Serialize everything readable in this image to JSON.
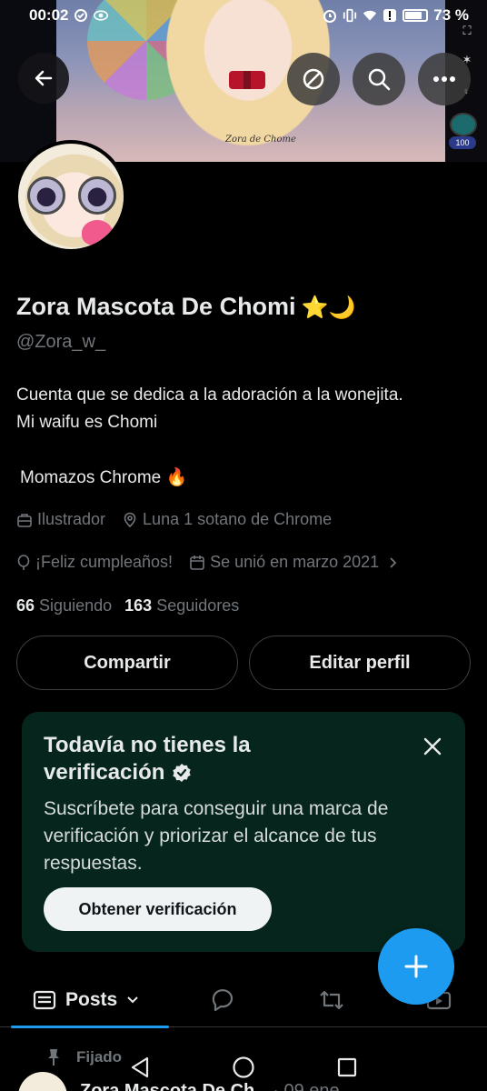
{
  "status_bar": {
    "time": "00:02",
    "battery": "73 %",
    "icons": [
      "data-saver-icon",
      "eye-icon",
      "alarm-icon",
      "vibrate-icon",
      "wifi-icon",
      "alert-icon",
      "battery-icon"
    ]
  },
  "banner": {
    "signature": "Zora de Chome",
    "sidebar_badge": "100"
  },
  "nav": {
    "icons": [
      "back-arrow-icon",
      "data-saver-icon",
      "search-icon",
      "more-icon"
    ]
  },
  "profile": {
    "name": "Zora Mascota De Chomi",
    "name_emoji": "⭐🌙",
    "handle": "@Zora_w_",
    "bio_line1": "Cuenta que se dedica a la adoración a la wonejita.",
    "bio_line2": "Mi waifu es Chomi",
    "bio_line3": "Momazos Chrome 🔥",
    "job": "Ilustrador",
    "location": "Luna 1 sotano de Chrome",
    "birthday": "¡Feliz cumpleaños!",
    "joined": "Se unió en marzo 2021",
    "following_count": "66",
    "following_label": "Siguiendo",
    "followers_count": "163",
    "followers_label": "Seguidores"
  },
  "buttons": {
    "share": "Compartir",
    "edit": "Editar perfil"
  },
  "verification": {
    "title_line1": "Todavía no tienes la",
    "title_line2": "verificación",
    "body": "Suscríbete para conseguir una marca de verificación y priorizar el alcance de tus respuestas.",
    "cta": "Obtener verificación"
  },
  "tabs": {
    "posts": "Posts"
  },
  "pinned": {
    "label": "Fijado",
    "author": "Zora Mascota De Ch",
    "date": "· 09 ene"
  },
  "colors": {
    "accent": "#1d9bf0",
    "card_bg": "#06261d",
    "muted": "#71767b",
    "text": "#e7e9ea"
  }
}
